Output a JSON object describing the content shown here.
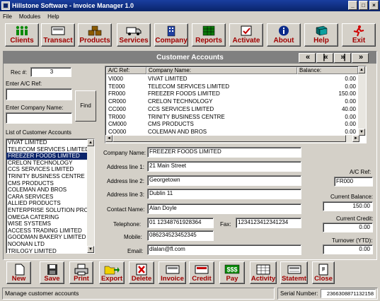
{
  "window": {
    "title": "Hillstone Software - Invoice Manager 1.0"
  },
  "menu": [
    "File",
    "Modules",
    "Help"
  ],
  "toolbar": [
    {
      "label": "Clients",
      "icon": "clients-icon"
    },
    {
      "label": "Transact",
      "icon": "transact-icon"
    },
    {
      "label": "Products",
      "icon": "products-icon"
    },
    {
      "label": "Services",
      "icon": "services-icon"
    },
    {
      "label": "Company",
      "icon": "company-icon"
    },
    {
      "label": "Reports",
      "icon": "reports-icon"
    },
    {
      "label": "Activate",
      "icon": "activate-icon"
    },
    {
      "label": "About",
      "icon": "about-icon"
    },
    {
      "label": "Help",
      "icon": "help-book-icon"
    },
    {
      "label": "Exit",
      "icon": "exit-icon"
    }
  ],
  "panel": {
    "title": "Customer Accounts",
    "nav": [
      "«",
      "|«",
      "»|",
      "»"
    ]
  },
  "search": {
    "rec_label": "Rec #:",
    "rec_value": "3",
    "ac_label": "Enter A/C Ref:",
    "ac_value": "",
    "company_label": "Enter Company Name:",
    "company_value": "",
    "find_label": "Find",
    "list_label": "List of Customer Accounts"
  },
  "customers": [
    "VIVAT LIMITED",
    "TELECOM SERVICES LIMITED",
    "FREEZER FOODS LIMITED",
    "CRELON TECHNOLOGY",
    "CCS SERVICES LIMITED",
    "TRINITY BUSINESS CENTRE",
    "CMS PRODUCTS",
    "COLEMAN AND BROS",
    "CARA SERVICES",
    "ALLIED PRODUCTS",
    "ENTERPRISE SOLUTION PRO",
    "OMEGA CATERING",
    "WISE SYSTEMS",
    "ACCESS TRADING LIMITED",
    "GOODMAN BAKERY LIMITED",
    "NOONAN LTD",
    "TRILOGY LIMITED"
  ],
  "selected_customer": "FREEZER FOODS LIMITED",
  "grid": {
    "headers": [
      "A/C Ref:",
      "Company Name:",
      "Balance:"
    ],
    "rows": [
      [
        "VI000",
        "VIVAT LIMITED",
        "0.00"
      ],
      [
        "TE000",
        "TELECOM SERVICES LIMITED",
        "0.00"
      ],
      [
        "FR000",
        "FREEZER FOODS LIMITED",
        "150.00"
      ],
      [
        "CR000",
        "CRELON TECHNOLOGY",
        "0.00"
      ],
      [
        "CC000",
        "CCS SERVICES LIMITED",
        "40.00"
      ],
      [
        "TR000",
        "TRINITY BUSINESS CENTRE",
        "0.00"
      ],
      [
        "CM000",
        "CMS PRODUCTS",
        "0.00"
      ],
      [
        "CO000",
        "COLEMAN AND BROS",
        "0.00"
      ]
    ]
  },
  "details": {
    "company_name_label": "Company Name:",
    "company_name": "FREEZER FOODS LIMITED",
    "address1_label": "Address line 1:",
    "address1": "21 Main Street",
    "address2_label": "Address line 2:",
    "address2": "Georgetown",
    "address3_label": "Address line 3:",
    "address3": "Dublin 11",
    "contact_label": "Contact Name:",
    "contact": "Alan Doyle",
    "telephone_label": "Telephone:",
    "telephone": "01 12348761928364",
    "fax_label": "Fax:",
    "fax": "1234123412341234",
    "mobile_label": "Mobile:",
    "mobile": "086234523452345",
    "email_label": "Email:",
    "email": "dlalan@fl.com"
  },
  "account": {
    "ac_ref_label": "A/C Ref:",
    "ac_ref": "FR000",
    "balance_label": "Current Balance:",
    "balance": "150.00",
    "credit_label": "Current Credit:",
    "credit": "0.00",
    "turnover_label": "Turnover (YTD):",
    "turnover": "0.00"
  },
  "actions": [
    {
      "label": "New",
      "icon": "new-document-icon"
    },
    {
      "label": "Save",
      "icon": "save-disk-icon"
    },
    {
      "label": "Print",
      "icon": "printer-icon"
    },
    {
      "label": "Export",
      "icon": "export-folder-icon"
    },
    {
      "label": "Delete",
      "icon": "delete-x-icon"
    },
    {
      "label": "Invoice",
      "icon": "invoice-icon"
    },
    {
      "label": "Credit",
      "icon": "credit-icon"
    },
    {
      "label": "Pay",
      "icon": "pay-dollar-icon"
    },
    {
      "label": "Activity",
      "icon": "activity-grid-icon"
    },
    {
      "label": "Statemt",
      "icon": "statement-icon"
    },
    {
      "label": "Close",
      "icon": "close-door-icon"
    }
  ],
  "status": {
    "message": "Manage customer accounts",
    "serial_label": "Serial Number:",
    "serial": "2366308871132158"
  }
}
